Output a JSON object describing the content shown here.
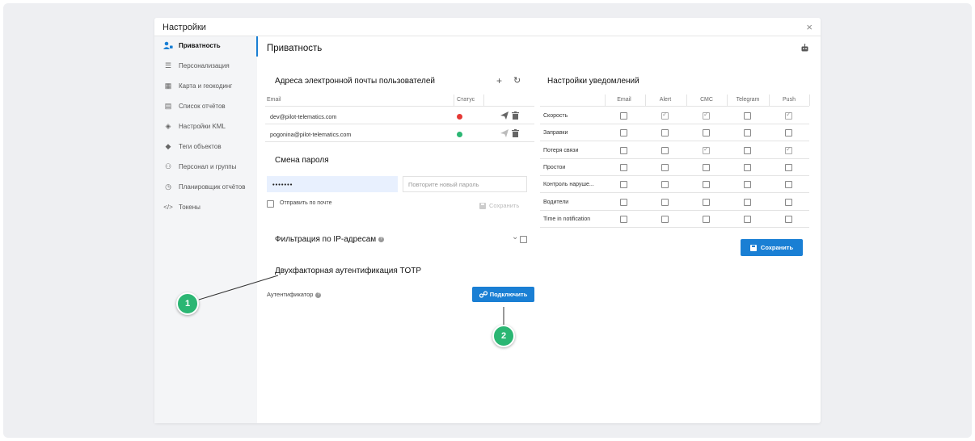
{
  "dialog": {
    "title": "Настройки",
    "close_icon": "×"
  },
  "sidebar": {
    "items": [
      {
        "label": "Приватность",
        "icon": "user-lock-icon",
        "glyph": "👤"
      },
      {
        "label": "Персонализация",
        "icon": "list-icon",
        "glyph": "☰"
      },
      {
        "label": "Карта и геокодинг",
        "icon": "map-icon",
        "glyph": "▦"
      },
      {
        "label": "Список отчётов",
        "icon": "report-list-icon",
        "glyph": "▤"
      },
      {
        "label": "Настройки KML",
        "icon": "layers-icon",
        "glyph": "◈"
      },
      {
        "label": "Теги объектов",
        "icon": "tag-icon",
        "glyph": "◆"
      },
      {
        "label": "Персонал и группы",
        "icon": "users-icon",
        "glyph": "⚇"
      },
      {
        "label": "Планировщик отчётов",
        "icon": "clock-icon",
        "glyph": "◷"
      },
      {
        "label": "Токены",
        "icon": "code-icon",
        "glyph": "</>"
      }
    ]
  },
  "main": {
    "title": "Приватность",
    "robot_icon": "robot-icon"
  },
  "emails": {
    "title": "Адреса электронной почты пользователей",
    "add_icon": "+",
    "refresh_icon": "↻",
    "headers": {
      "email": "Email",
      "status": "Статус"
    },
    "rows": [
      {
        "email": "dev@pilot-telematics.com",
        "status_color": "#e53935"
      },
      {
        "email": "pogonina@pilot-telematics.com",
        "status_color": "#2bb673"
      }
    ]
  },
  "password": {
    "title": "Смена пароля",
    "value": "•••••••",
    "repeat_placeholder": "Повторите новый пароль",
    "send_label": "Отправить по почте",
    "save_label": "Сохранить"
  },
  "ip_filter": {
    "title": "Фильтрация по IP-адресам",
    "chevron": "⌄"
  },
  "totp": {
    "title": "Двухфакторная аутентификация TOTP",
    "auth_label": "Аутентификатор",
    "connect_label": "Подключить"
  },
  "notifications": {
    "title": "Настройки уведомлений",
    "columns": [
      "Email",
      "Alert",
      "СМС",
      "Telegram",
      "Push"
    ],
    "rows": [
      {
        "label": "Скорость",
        "checks": [
          false,
          true,
          true,
          false,
          true
        ]
      },
      {
        "label": "Заправки",
        "checks": [
          false,
          false,
          false,
          false,
          false
        ]
      },
      {
        "label": "Потеря связи",
        "checks": [
          false,
          false,
          true,
          false,
          true
        ]
      },
      {
        "label": "Простои",
        "checks": [
          false,
          false,
          false,
          false,
          false
        ]
      },
      {
        "label": "Контроль наруше...",
        "checks": [
          false,
          false,
          false,
          false,
          false
        ]
      },
      {
        "label": "Водители",
        "checks": [
          false,
          false,
          false,
          false,
          false
        ]
      },
      {
        "label": "Time in notification",
        "checks": [
          false,
          false,
          false,
          false,
          false
        ]
      }
    ],
    "save_label": "Сохранить"
  },
  "callouts": {
    "one": "1",
    "two": "2"
  }
}
